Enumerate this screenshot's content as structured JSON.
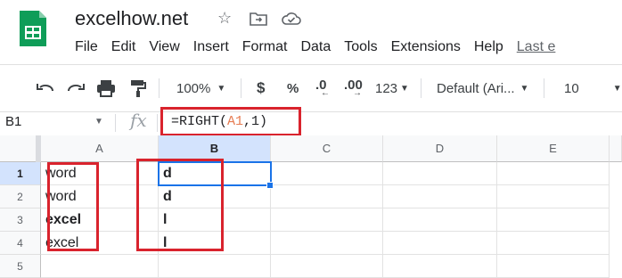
{
  "app": {
    "doc_title": "excelhow.net"
  },
  "menu": [
    "File",
    "Edit",
    "View",
    "Insert",
    "Format",
    "Data",
    "Tools",
    "Extensions",
    "Help"
  ],
  "menu_last": "Last e",
  "toolbar": {
    "zoom": "100%",
    "currency": "$",
    "percent": "%",
    "dec_decrease": ".0",
    "dec_increase": ".00",
    "more_formats": "123",
    "font": "Default (Ari...",
    "font_size": "10"
  },
  "formula_bar": {
    "name_box": "B1",
    "fx": "fx",
    "formula_prefix": "=RIGHT(",
    "formula_ref": "A1",
    "formula_suffix": ",1)"
  },
  "columns": [
    "A",
    "B",
    "C",
    "D",
    "E"
  ],
  "rows": [
    "1",
    "2",
    "3",
    "4",
    "5"
  ],
  "cells": {
    "A": [
      "word",
      "word",
      "excel",
      "excel",
      ""
    ],
    "B": [
      "d",
      "d",
      "l",
      "l",
      ""
    ]
  },
  "colors": {
    "accent": "#1a73e8",
    "highlight": "#d9232d",
    "sheets_green": "#0f9d58"
  }
}
